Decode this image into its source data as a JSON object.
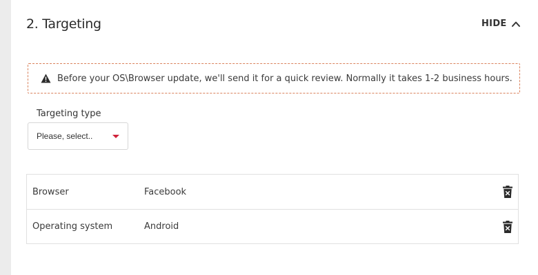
{
  "section": {
    "title": "2. Targeting",
    "toggle_label": "HIDE",
    "toggle_icon": "chevron-up-icon"
  },
  "notice": {
    "icon": "warning-icon",
    "text": "Before your OS\\Browser update, we'll send it for a quick review. Normally it takes 1-2 business hours.",
    "border_color": "#d9805a"
  },
  "targeting_type": {
    "label": "Targeting type",
    "value": "Please, select..",
    "caret_color": "#d0223a"
  },
  "targets": [
    {
      "type": "Browser",
      "value": "Facebook",
      "action_icon": "trash-icon"
    },
    {
      "type": "Operating system",
      "value": "Android",
      "action_icon": "trash-icon"
    }
  ]
}
